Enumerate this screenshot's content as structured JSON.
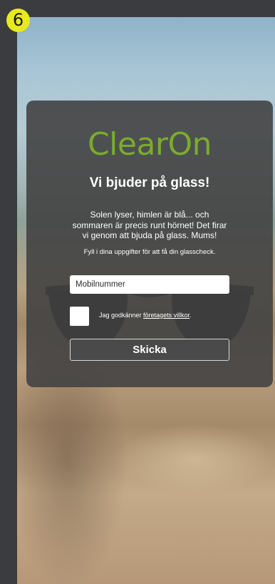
{
  "step_badge": "6",
  "brand": {
    "logo_text": "ClearOn",
    "accent_color": "#7aac2c"
  },
  "headline": "Vi bjuder på glass!",
  "intro": {
    "line1": "Solen lyser, himlen är blå... och",
    "line2": "sommaren är precis runt hörnet! Det firar",
    "line3": "vi genom att bjuda på glass. Mums!"
  },
  "hint": "Fyll i dina uppgifter för att få din glasscheck.",
  "form": {
    "phone_placeholder": "Mobilnummer",
    "terms_prefix": "Jag godkänner ",
    "terms_link": "företagets villkor",
    "terms_suffix": ".",
    "submit_label": "Skicka"
  },
  "colors": {
    "badge": "#e8ea1c",
    "card": "#424242",
    "page": "#3b3c3f"
  }
}
